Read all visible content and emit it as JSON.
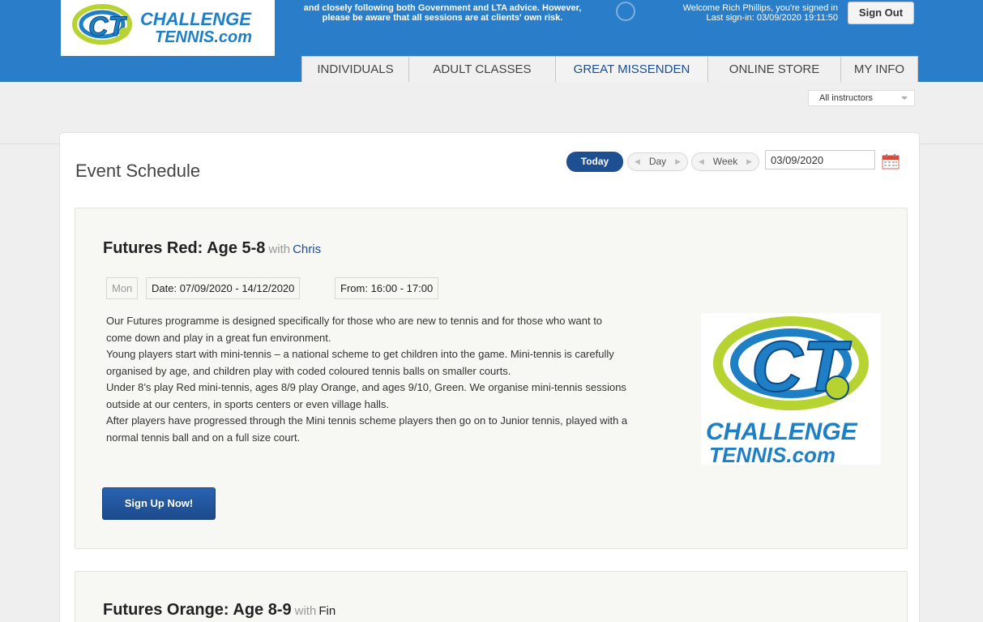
{
  "header": {
    "logo_text_line1": "CHALLENGE",
    "logo_text_line2": "TENNIS.com",
    "notice_line1": "and closely following both Government and LTA advice. However,",
    "notice_line2": "please be aware that all sessions are at clients' own risk.",
    "welcome_line1": "Welcome Rich Phillips, you're signed in",
    "welcome_line2": "Last sign-in: 03/09/2020 19:11:50",
    "signout_label": "Sign Out"
  },
  "tabs": [
    {
      "label": "INDIVIDUALS"
    },
    {
      "label": "ADULT CLASSES"
    },
    {
      "label": "GREAT MISSENDEN"
    },
    {
      "label": "ONLINE STORE"
    },
    {
      "label": "MY INFO"
    }
  ],
  "active_tab": "GREAT MISSENDEN",
  "filters": {
    "instructor_selected": "All instructors"
  },
  "schedule": {
    "title": "Event Schedule",
    "today_label": "Today",
    "day_label": "Day",
    "week_label": "Week",
    "date_value": "03/09/2020"
  },
  "events": [
    {
      "title": "Futures Red: Age 5-8",
      "with_label": "with",
      "instructor": "Chris",
      "day": "Mon",
      "date_label": "Date:",
      "date_range": "07/09/2020 - 14/12/2020",
      "from_label": "From:",
      "time_range": "16:00  - 17:00",
      "description": [
        "Our Futures programme is designed specifically for those who are new to tennis and for those who want to",
        "come down and play in a great fun environment.",
        "Young players start with mini-tennis – a national scheme to get children into the game. Mini-tennis is carefully",
        "organised by age, and children play with coded coloured tennis balls on smaller courts.",
        "Under 8’s play Red mini-tennis, ages 8/9 play Orange, and ages 9/10, Green. We organise mini-tennis sessions",
        "outside at our centers, in sports centers or even village halls.",
        "After players have progressed through the Mini tennis scheme players then go on to Junior tennis, played with a",
        "normal tennis ball and on a full size court."
      ],
      "logo_line1": "CHALLENGE",
      "logo_line2": "TENNIS.com",
      "signup_label": "Sign Up Now!"
    },
    {
      "title": "Futures Orange: Age 8-9",
      "with_label": "with",
      "instructor": "Fin"
    }
  ],
  "colors": {
    "header_blue": "#2a7ec9",
    "accent_navy": "#1e4f93",
    "logo_green": "#b7d332",
    "logo_blue": "#1f7fc5"
  }
}
